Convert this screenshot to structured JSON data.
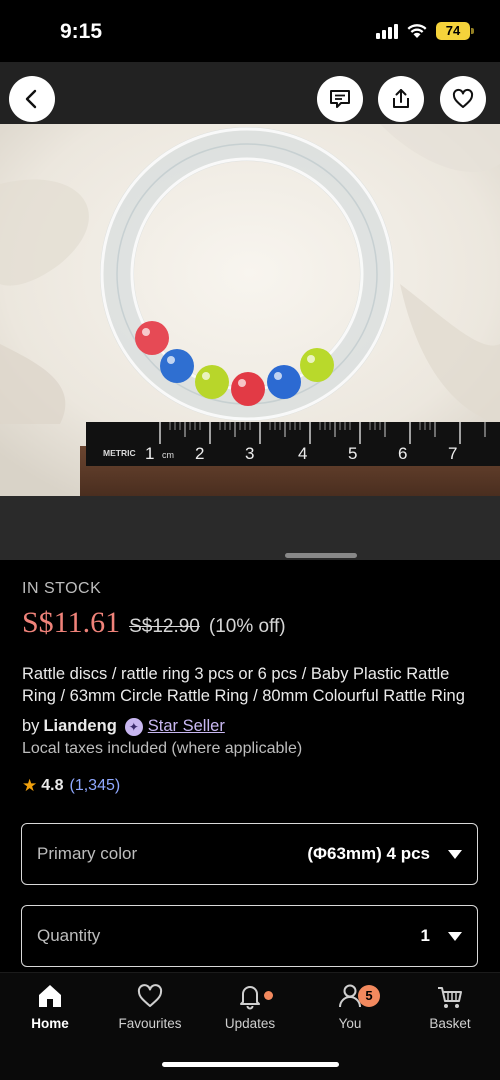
{
  "status_bar": {
    "time": "9:15",
    "battery": "74"
  },
  "top_bar": {
    "back_icon": "chevron-left-icon",
    "message_icon": "message-icon",
    "share_icon": "share-icon",
    "favourite_icon": "heart-icon"
  },
  "product_image": {
    "ruler_brand": "METRIC",
    "ruler_unit": "cm",
    "ruler_numbers": [
      "1",
      "2",
      "3",
      "4",
      "5",
      "6",
      "7"
    ]
  },
  "product": {
    "stock_status": "IN STOCK",
    "price_current": "S$11.61",
    "price_original": "S$12.90",
    "discount": "(10% off)",
    "title": "Rattle discs / rattle ring 3 pcs or 6 pcs / Baby Plastic Rattle Ring / 63mm Circle Rattle Ring / 80mm Colourful Rattle Ring",
    "seller_prefix": "by",
    "seller_name": "Liandeng",
    "seller_badge": "Star Seller",
    "taxes_note": "Local taxes included (where applicable)",
    "rating": "4.8",
    "review_count": "(1,345)"
  },
  "options": {
    "primary_color_label": "Primary color",
    "primary_color_value": "(Φ63mm)  4 pcs",
    "quantity_label": "Quantity",
    "quantity_value": "1"
  },
  "bottom_nav": {
    "items": [
      {
        "label": "Home",
        "icon": "home-icon"
      },
      {
        "label": "Favourites",
        "icon": "heart-icon"
      },
      {
        "label": "Updates",
        "icon": "bell-icon"
      },
      {
        "label": "You",
        "icon": "user-icon",
        "badge": "5"
      },
      {
        "label": "Basket",
        "icon": "basket-icon"
      }
    ]
  },
  "colors": {
    "price": "#f0837a",
    "accent_badge": "#f2895e",
    "link": "#8fa8ff",
    "star_seller": "#c9b8f2"
  }
}
